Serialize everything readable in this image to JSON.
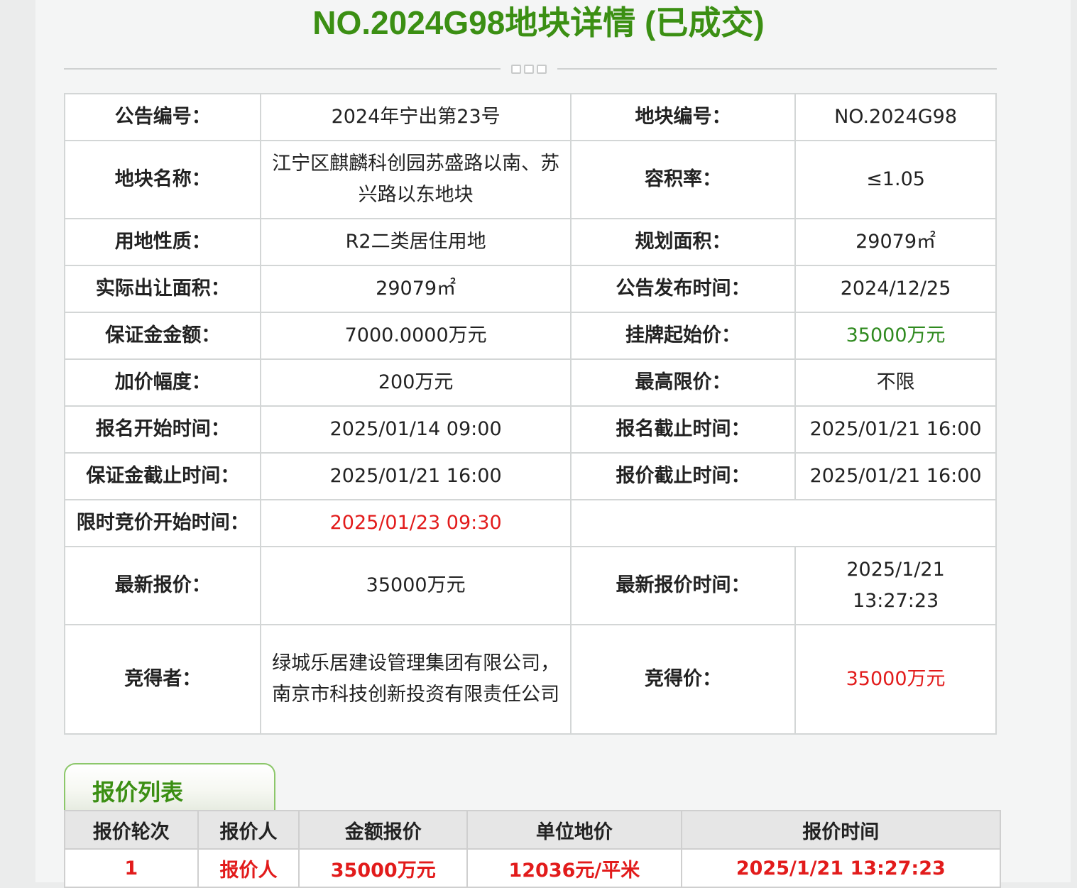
{
  "page": {
    "title": "NO.2024G98地块详情 (已成交)"
  },
  "info_rows": [
    [
      [
        "公告编号：",
        "2024年宁出第23号"
      ],
      [
        "地块编号：",
        "NO.2024G98"
      ]
    ],
    [
      [
        "地块名称：",
        "江宁区麒麟科创园苏盛路以南、苏兴路以东地块"
      ],
      [
        "容积率：",
        "≤1.05"
      ]
    ],
    [
      [
        "用地性质：",
        "R2二类居住用地"
      ],
      [
        "规划面积：",
        "29079㎡"
      ]
    ],
    [
      [
        "实际出让面积：",
        "29079㎡"
      ],
      [
        "公告发布时间：",
        "2024/12/25"
      ]
    ],
    [
      [
        "保证金金额：",
        "7000.0000万元"
      ],
      [
        "挂牌起始价：",
        "35000万元"
      ]
    ],
    [
      [
        "加价幅度：",
        "200万元"
      ],
      [
        "最高限价：",
        "不限"
      ]
    ],
    [
      [
        "报名开始时间：",
        "2025/01/14 09:00"
      ],
      [
        "报名截止时间：",
        "2025/01/21 16:00"
      ]
    ],
    [
      [
        "保证金截止时间：",
        "2025/01/21 16:00"
      ],
      [
        "报价截止时间：",
        "2025/01/21 16:00"
      ]
    ],
    [
      [
        "限时竞价开始时间：",
        "2025/01/23 09:30"
      ],
      [
        "",
        ""
      ]
    ],
    [
      [
        "最新报价：",
        "35000万元"
      ],
      [
        "最新报价时间：",
        "2025/1/21 13:27:23"
      ]
    ],
    [
      [
        "竞得者：",
        "绿城乐居建设管理集团有限公司，南京市科技创新投资有限责任公司"
      ],
      [
        "竞得价：",
        "35000万元"
      ]
    ]
  ],
  "colors": {
    "title_green": "#3b8f13",
    "value_green": "#2f8a1f",
    "value_red": "#e21b1b"
  },
  "bid_list": {
    "tab_label": "报价列表",
    "headers": [
      "报价轮次",
      "报价人",
      "金额报价",
      "单位地价",
      "报价时间"
    ],
    "rows": [
      [
        "1",
        "报价人",
        "35000万元",
        "12036元/平米",
        "2025/1/21 13:27:23"
      ]
    ]
  }
}
